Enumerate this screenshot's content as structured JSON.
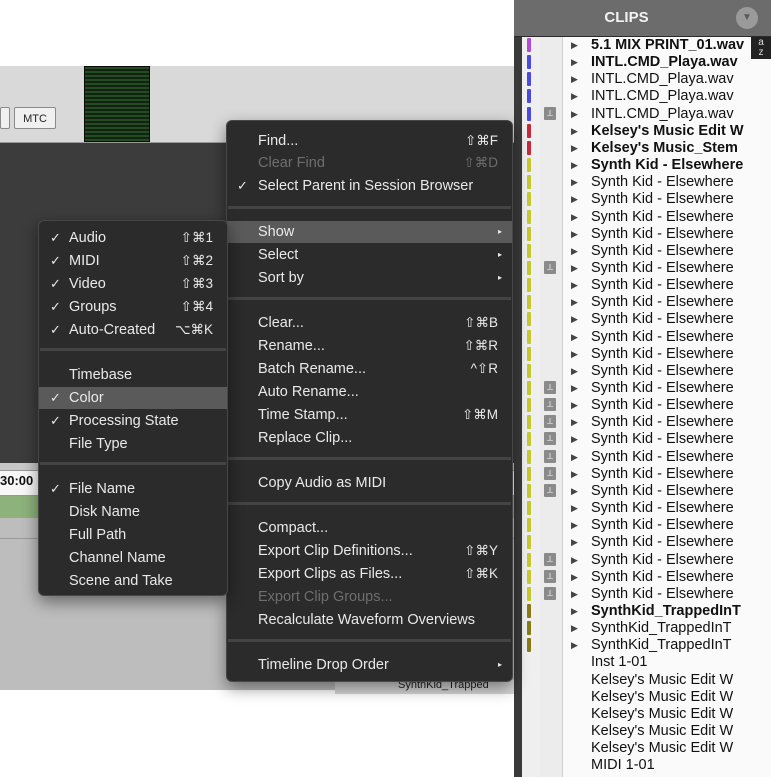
{
  "toolbar": {
    "mtc_label": "MTC"
  },
  "timeline": {
    "timecode": "30:00",
    "lower_clip_label": "SynthKid_Trapped"
  },
  "main_menu": {
    "items": [
      {
        "label": "Find...",
        "shortcut": "⇧⌘F",
        "check": "",
        "disabled": false,
        "submenu": false
      },
      {
        "label": "Clear Find",
        "shortcut": "⇧⌘D",
        "check": "",
        "disabled": true,
        "submenu": false
      },
      {
        "label": "Select Parent in Session Browser",
        "shortcut": "",
        "check": "✓",
        "disabled": false,
        "submenu": false
      },
      {
        "label": "Show",
        "shortcut": "",
        "check": "",
        "disabled": false,
        "submenu": true,
        "highlighted": true
      },
      {
        "label": "Select",
        "shortcut": "",
        "check": "",
        "disabled": false,
        "submenu": true
      },
      {
        "label": "Sort by",
        "shortcut": "",
        "check": "",
        "disabled": false,
        "submenu": true
      },
      {
        "label": "Clear...",
        "shortcut": "⇧⌘B",
        "check": "",
        "disabled": false,
        "submenu": false
      },
      {
        "label": "Rename...",
        "shortcut": "⇧⌘R",
        "check": "",
        "disabled": false,
        "submenu": false
      },
      {
        "label": "Batch Rename...",
        "shortcut": "^⇧R",
        "check": "",
        "disabled": false,
        "submenu": false
      },
      {
        "label": "Auto Rename...",
        "shortcut": "",
        "check": "",
        "disabled": false,
        "submenu": false
      },
      {
        "label": "Time Stamp...",
        "shortcut": "⇧⌘M",
        "check": "",
        "disabled": false,
        "submenu": false
      },
      {
        "label": "Replace Clip...",
        "shortcut": "",
        "check": "",
        "disabled": false,
        "submenu": false
      },
      {
        "label": "Copy Audio as MIDI",
        "shortcut": "",
        "check": "",
        "disabled": false,
        "submenu": false
      },
      {
        "label": "Compact...",
        "shortcut": "",
        "check": "",
        "disabled": false,
        "submenu": false
      },
      {
        "label": "Export Clip Definitions...",
        "shortcut": "⇧⌘Y",
        "check": "",
        "disabled": false,
        "submenu": false
      },
      {
        "label": "Export Clips as Files...",
        "shortcut": "⇧⌘K",
        "check": "",
        "disabled": false,
        "submenu": false
      },
      {
        "label": "Export Clip Groups...",
        "shortcut": "",
        "check": "",
        "disabled": true,
        "submenu": false
      },
      {
        "label": "Recalculate Waveform Overviews",
        "shortcut": "",
        "check": "",
        "disabled": false,
        "submenu": false
      },
      {
        "label": "Timeline Drop Order",
        "shortcut": "",
        "check": "",
        "disabled": false,
        "submenu": true
      }
    ],
    "submenu_arrow": "▸"
  },
  "show_submenu": {
    "items": [
      {
        "label": "Audio",
        "shortcut": "⇧⌘1",
        "check": "✓"
      },
      {
        "label": "MIDI",
        "shortcut": "⇧⌘2",
        "check": "✓"
      },
      {
        "label": "Video",
        "shortcut": "⇧⌘3",
        "check": "✓"
      },
      {
        "label": "Groups",
        "shortcut": "⇧⌘4",
        "check": "✓"
      },
      {
        "label": "Auto-Created",
        "shortcut": "⌥⌘K",
        "check": "✓"
      },
      {
        "label": "Timebase",
        "shortcut": "",
        "check": ""
      },
      {
        "label": "Color",
        "shortcut": "",
        "check": "✓",
        "highlighted": true
      },
      {
        "label": "Processing State",
        "shortcut": "",
        "check": "✓"
      },
      {
        "label": "File Type",
        "shortcut": "",
        "check": ""
      },
      {
        "label": "File Name",
        "shortcut": "",
        "check": "✓"
      },
      {
        "label": "Disk Name",
        "shortcut": "",
        "check": ""
      },
      {
        "label": "Full Path",
        "shortcut": "",
        "check": ""
      },
      {
        "label": "Channel Name",
        "shortcut": "",
        "check": ""
      },
      {
        "label": "Scene and Take",
        "shortcut": "",
        "check": ""
      }
    ]
  },
  "clips_panel": {
    "title": "CLIPS",
    "menu_icon": "chevron-down-icon",
    "sort_badge_top": "a",
    "sort_badge_bottom": "z",
    "link_glyph": "⟂",
    "expand_glyph": "▶",
    "colors": {
      "purple": "#b04ad8",
      "blue": "#4a4ae0",
      "red": "#c8283c",
      "yellow": "#c8c830",
      "olive": "#8a7a18"
    },
    "rows": [
      {
        "name": "5.1 MIX PRINT_01.wav",
        "bold": true,
        "color": "#b04ad8",
        "link": false,
        "expand": true
      },
      {
        "name": "INTL.CMD_Playa.wav",
        "bold": true,
        "color": "#4a4ae0",
        "link": false,
        "expand": true
      },
      {
        "name": "INTL.CMD_Playa.wav",
        "bold": false,
        "color": "#4a4ae0",
        "link": false,
        "expand": true
      },
      {
        "name": "INTL.CMD_Playa.wav",
        "bold": false,
        "color": "#4a4ae0",
        "link": false,
        "expand": true
      },
      {
        "name": "INTL.CMD_Playa.wav",
        "bold": false,
        "color": "#4a4ae0",
        "link": true,
        "expand": true
      },
      {
        "name": "Kelsey's Music Edit W",
        "bold": true,
        "color": "#c8283c",
        "link": false,
        "expand": true
      },
      {
        "name": "Kelsey's Music_Stem",
        "bold": true,
        "color": "#c8283c",
        "link": false,
        "expand": true
      },
      {
        "name": "Synth Kid - Elsewhere",
        "bold": true,
        "color": "#c8c830",
        "link": false,
        "expand": true
      },
      {
        "name": "Synth Kid - Elsewhere",
        "bold": false,
        "color": "#c8c830",
        "link": false,
        "expand": true
      },
      {
        "name": "Synth Kid - Elsewhere",
        "bold": false,
        "color": "#c8c830",
        "link": false,
        "expand": true
      },
      {
        "name": "Synth Kid - Elsewhere",
        "bold": false,
        "color": "#c8c830",
        "link": false,
        "expand": true
      },
      {
        "name": "Synth Kid - Elsewhere",
        "bold": false,
        "color": "#c8c830",
        "link": false,
        "expand": true
      },
      {
        "name": "Synth Kid - Elsewhere",
        "bold": false,
        "color": "#c8c830",
        "link": false,
        "expand": true
      },
      {
        "name": "Synth Kid - Elsewhere",
        "bold": false,
        "color": "#c8c830",
        "link": true,
        "expand": true
      },
      {
        "name": "Synth Kid - Elsewhere",
        "bold": false,
        "color": "#c8c830",
        "link": false,
        "expand": true
      },
      {
        "name": "Synth Kid - Elsewhere",
        "bold": false,
        "color": "#c8c830",
        "link": false,
        "expand": true
      },
      {
        "name": "Synth Kid - Elsewhere",
        "bold": false,
        "color": "#c8c830",
        "link": false,
        "expand": true
      },
      {
        "name": "Synth Kid - Elsewhere",
        "bold": false,
        "color": "#c8c830",
        "link": false,
        "expand": true
      },
      {
        "name": "Synth Kid - Elsewhere",
        "bold": false,
        "color": "#c8c830",
        "link": false,
        "expand": true
      },
      {
        "name": "Synth Kid - Elsewhere",
        "bold": false,
        "color": "#c8c830",
        "link": false,
        "expand": true
      },
      {
        "name": "Synth Kid - Elsewhere",
        "bold": false,
        "color": "#c8c830",
        "link": true,
        "expand": true
      },
      {
        "name": "Synth Kid - Elsewhere",
        "bold": false,
        "color": "#c8c830",
        "link": true,
        "expand": true
      },
      {
        "name": "Synth Kid - Elsewhere",
        "bold": false,
        "color": "#c8c830",
        "link": true,
        "expand": true
      },
      {
        "name": "Synth Kid - Elsewhere",
        "bold": false,
        "color": "#c8c830",
        "link": true,
        "expand": true
      },
      {
        "name": "Synth Kid - Elsewhere",
        "bold": false,
        "color": "#c8c830",
        "link": true,
        "expand": true
      },
      {
        "name": "Synth Kid - Elsewhere",
        "bold": false,
        "color": "#c8c830",
        "link": true,
        "expand": true
      },
      {
        "name": "Synth Kid - Elsewhere",
        "bold": false,
        "color": "#c8c830",
        "link": true,
        "expand": true
      },
      {
        "name": "Synth Kid - Elsewhere",
        "bold": false,
        "color": "#c8c830",
        "link": false,
        "expand": true
      },
      {
        "name": "Synth Kid - Elsewhere",
        "bold": false,
        "color": "#c8c830",
        "link": false,
        "expand": true
      },
      {
        "name": "Synth Kid - Elsewhere",
        "bold": false,
        "color": "#c8c830",
        "link": false,
        "expand": true
      },
      {
        "name": "Synth Kid - Elsewhere",
        "bold": false,
        "color": "#c8c830",
        "link": true,
        "expand": true
      },
      {
        "name": "Synth Kid - Elsewhere",
        "bold": false,
        "color": "#c8c830",
        "link": true,
        "expand": true
      },
      {
        "name": "Synth Kid - Elsewhere",
        "bold": false,
        "color": "#c8c830",
        "link": true,
        "expand": true
      },
      {
        "name": "SynthKid_TrappedInT",
        "bold": true,
        "color": "#8a7a18",
        "link": false,
        "expand": true
      },
      {
        "name": "SynthKid_TrappedInT",
        "bold": false,
        "color": "#8a7a18",
        "link": false,
        "expand": true
      },
      {
        "name": "SynthKid_TrappedInT",
        "bold": false,
        "color": "#8a7a18",
        "link": false,
        "expand": true
      },
      {
        "name": "Inst 1-01",
        "bold": false,
        "color": "",
        "link": false,
        "expand": false
      },
      {
        "name": "Kelsey's Music Edit W",
        "bold": false,
        "color": "",
        "link": false,
        "expand": false
      },
      {
        "name": "Kelsey's Music Edit W",
        "bold": false,
        "color": "",
        "link": false,
        "expand": false
      },
      {
        "name": "Kelsey's Music Edit W",
        "bold": false,
        "color": "",
        "link": false,
        "expand": false
      },
      {
        "name": "Kelsey's Music Edit W",
        "bold": false,
        "color": "",
        "link": false,
        "expand": false
      },
      {
        "name": "Kelsey's Music Edit W",
        "bold": false,
        "color": "",
        "link": false,
        "expand": false
      },
      {
        "name": "MIDI 1-01",
        "bold": false,
        "color": "",
        "link": false,
        "expand": false
      }
    ]
  }
}
